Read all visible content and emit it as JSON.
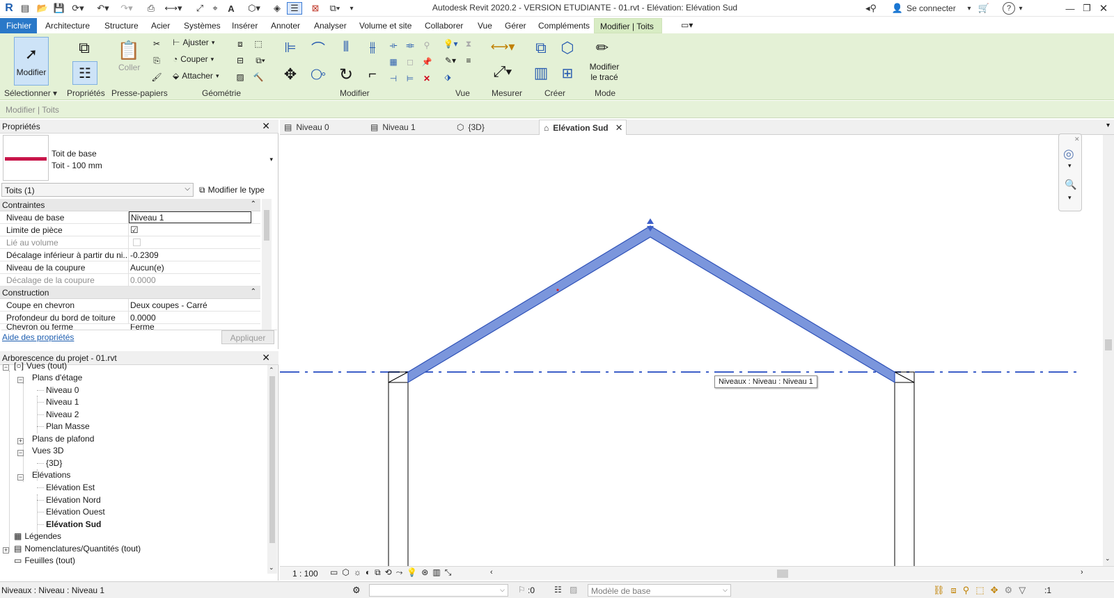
{
  "app": {
    "title": "Autodesk Revit 2020.2 - VERSION ETUDIANTE - 01.rvt - Elévation: Elévation Sud",
    "sign_in": "Se connecter",
    "help": "?"
  },
  "menu": {
    "file": "Fichier",
    "items": [
      "Architecture",
      "Structure",
      "Acier",
      "Systèmes",
      "Insérer",
      "Annoter",
      "Analyser",
      "Volume et site",
      "Collaborer",
      "Vue",
      "Gérer",
      "Compléments"
    ],
    "active": "Modifier | Toits"
  },
  "ribbon": {
    "modify_button": "Modifier",
    "paste_label": "Coller",
    "geometry_buttons": [
      "Ajuster",
      "Couper",
      "Attacher"
    ],
    "edit_footprint": [
      "Modifier",
      "le tracé"
    ],
    "panels": {
      "select": "Sélectionner",
      "properties": "Propriétés",
      "clipboard": "Presse-papiers",
      "geometry": "Géométrie",
      "modify": "Modifier",
      "view": "Vue",
      "measure": "Mesurer",
      "create": "Créer",
      "mode": "Mode"
    }
  },
  "context_bar": "Modifier | Toits",
  "properties": {
    "title": "Propriétés",
    "family": "Toit de base",
    "type": "Toit - 100 mm",
    "filter": "Toits (1)",
    "edit_type": "Modifier le type",
    "sections": [
      {
        "name": "Contraintes",
        "rows": [
          {
            "key": "Niveau de base",
            "value": "Niveau 1"
          },
          {
            "key": "Limite de pièce",
            "value": "☑"
          },
          {
            "key": "Lié au volume",
            "value": ""
          },
          {
            "key": "Décalage inférieur à partir du ni...",
            "value": "-0.2309"
          },
          {
            "key": "Niveau de la coupure",
            "value": "Aucun(e)"
          },
          {
            "key": "Décalage de la coupure",
            "value": "0.0000"
          }
        ]
      },
      {
        "name": "Construction",
        "rows": [
          {
            "key": "Coupe en chevron",
            "value": "Deux coupes - Carré"
          },
          {
            "key": "Profondeur du bord de toiture",
            "value": "0.0000"
          },
          {
            "key": "Chevron ou ferme",
            "value": "Ferme"
          }
        ]
      }
    ],
    "help_link": "Aide des propriétés",
    "apply": "Appliquer"
  },
  "browser": {
    "title": "Arborescence du projet - 01.rvt",
    "tree": {
      "views": "Vues (tout)",
      "floor_plans": "Plans d'étage",
      "floor_plan_items": [
        "Niveau 0",
        "Niveau 1",
        "Niveau 2",
        "Plan Masse"
      ],
      "ceiling_plans": "Plans de plafond",
      "views_3d": "Vues 3D",
      "views_3d_items": [
        "{3D}"
      ],
      "elevations": "Elévations",
      "elevation_items": [
        "Elévation Est",
        "Elévation Nord",
        "Elévation Ouest",
        "Elévation Sud"
      ],
      "legends": "Légendes",
      "schedules": "Nomenclatures/Quantités (tout)",
      "sheets": "Feuilles (tout)"
    }
  },
  "tabs": [
    {
      "label": "Niveau 0"
    },
    {
      "label": "Niveau 1"
    },
    {
      "label": "{3D}"
    },
    {
      "label": "Elévation Sud"
    }
  ],
  "canvas": {
    "level_tooltip": "Niveaux : Niveau : Niveau 1",
    "roof_color": "#7b96dc",
    "level_color": "#3d5fc8"
  },
  "view_bar": {
    "scale": "1 : 100"
  },
  "status": {
    "text": "Niveaux : Niveau : Niveau 1",
    "selection_count": ":0",
    "model": "Modèle de base",
    "filter_count": ":1"
  }
}
